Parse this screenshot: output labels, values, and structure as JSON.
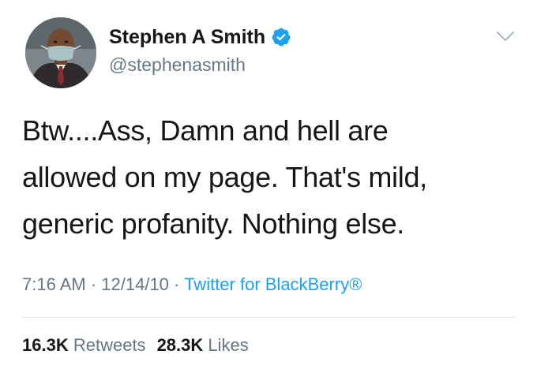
{
  "author": {
    "display_name": "Stephen A Smith",
    "handle": "@stephenasmith",
    "verified": true,
    "avatar_icon": "profile-photo-masked-man"
  },
  "tweet": {
    "lines": [
      "Btw....Ass, Damn and hell are",
      "allowed on my page. That's mild,",
      "generic profanity. Nothing else."
    ]
  },
  "meta": {
    "time": "7:16 AM",
    "separator": " · ",
    "date": "12/14/10",
    "source": "Twitter for BlackBerry®"
  },
  "stats": {
    "retweets_count": "16.3K",
    "retweets_label": "Retweets",
    "likes_count": "28.3K",
    "likes_label": "Likes"
  },
  "colors": {
    "text": "#14171a",
    "secondary": "#657786",
    "link": "#1da1f2",
    "verified": "#1da1f2",
    "divider": "#e1e8ed"
  },
  "icons": {
    "verified": "verified-badge-icon",
    "menu": "chevron-down-icon"
  }
}
